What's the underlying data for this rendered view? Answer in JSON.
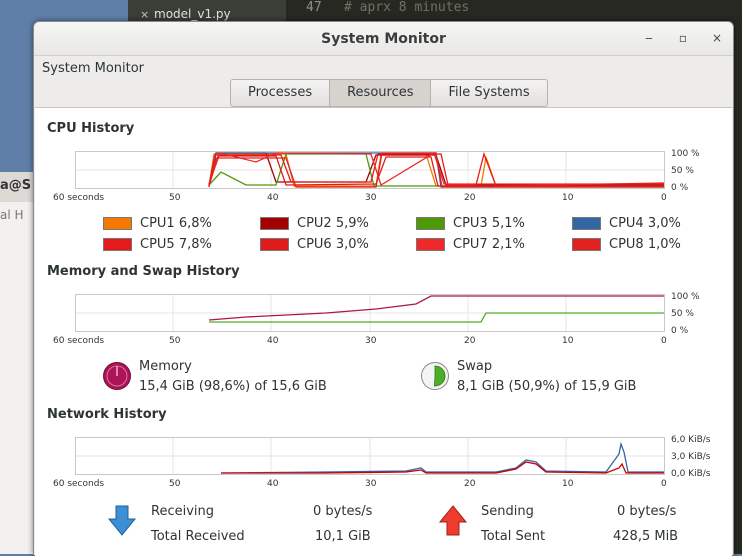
{
  "background": {
    "editor_tab": "model_v1.py",
    "editor_tab_close": "×",
    "line_numbers": [
      "47"
    ],
    "code_lines": [
      "# aprx 8 minutes"
    ],
    "terminal_host": "a@S",
    "terminal_text": "al  H"
  },
  "window": {
    "title": "System Monitor",
    "minimize": "‒",
    "maximize": "▫",
    "close": "×",
    "menu": "System Monitor"
  },
  "tabs": [
    {
      "label": "Processes",
      "active": false
    },
    {
      "label": "Resources",
      "active": true
    },
    {
      "label": "File Systems",
      "active": false
    }
  ],
  "x_ticks": [
    "60 seconds",
    "50",
    "40",
    "30",
    "20",
    "10",
    "0"
  ],
  "cpu": {
    "title": "CPU History",
    "y_ticks": [
      "100 %",
      "50 %",
      "0 %"
    ],
    "legend": [
      {
        "label": "CPU1",
        "value": "6,8%",
        "color": "#f57900"
      },
      {
        "label": "CPU2",
        "value": "5,9%",
        "color": "#a40000"
      },
      {
        "label": "CPU3",
        "value": "5,1%",
        "color": "#4e9a06"
      },
      {
        "label": "CPU4",
        "value": "3,0%",
        "color": "#3465a4"
      },
      {
        "label": "CPU5",
        "value": "7,8%",
        "color": "#e61a1a"
      },
      {
        "label": "CPU6",
        "value": "3,0%",
        "color": "#e01b1b"
      },
      {
        "label": "CPU7",
        "value": "2,1%",
        "color": "#ef2929"
      },
      {
        "label": "CPU8",
        "value": "1,0%",
        "color": "#e22020"
      }
    ]
  },
  "memory": {
    "title": "Memory and Swap History",
    "y_ticks": [
      "100 %",
      "50 %",
      "0 %"
    ],
    "memory_label": "Memory",
    "memory_value": "15,4 GiB (98,6%) of 15,6 GiB",
    "memory_fraction": 0.986,
    "memory_color": "#ad1457",
    "swap_label": "Swap",
    "swap_value": "8,1 GiB (50,9%) of 15,9 GiB",
    "swap_fraction": 0.509,
    "swap_color": "#4caf28"
  },
  "network": {
    "title": "Network History",
    "y_ticks": [
      "6,0 KiB/s",
      "3,0 KiB/s",
      "0,0 KiB/s"
    ],
    "receiving_label": "Receiving",
    "receiving_value": "0 bytes/s",
    "total_received_label": "Total Received",
    "total_received_value": "10,1 GiB",
    "sending_label": "Sending",
    "sending_value": "0 bytes/s",
    "total_sent_label": "Total Sent",
    "total_sent_value": "428,5 MiB",
    "receive_icon": "arrow-down-icon",
    "send_icon": "arrow-up-icon"
  }
}
